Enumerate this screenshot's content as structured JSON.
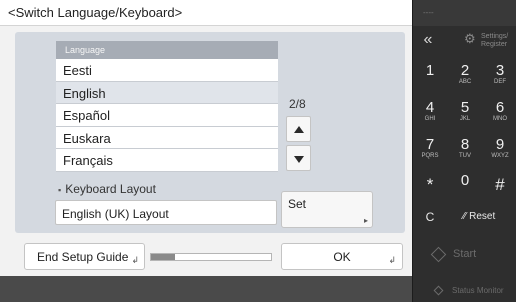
{
  "title": "<Switch Language/Keyboard>",
  "language_list": {
    "header": "Language",
    "items": [
      "Eesti",
      "English",
      "Español",
      "Euskara",
      "Français"
    ],
    "selected": "English"
  },
  "pager": {
    "indicator": "2/8",
    "up_icon": "triangle-up",
    "down_icon": "triangle-down"
  },
  "keyboard": {
    "label": "Keyboard Layout",
    "value": "English (UK) Layout",
    "set_label": "Set"
  },
  "footer": {
    "end_setup_label": "End Setup Guide",
    "progress_fraction": 0.2,
    "ok_label": "OK"
  },
  "keypad": {
    "top_indicator": "----",
    "back_icon": "double-chevron-left",
    "settings_line1": "Settings/",
    "settings_line2": "Register",
    "keys": [
      {
        "main": "1",
        "sub": ""
      },
      {
        "main": "2",
        "sub": "ABC"
      },
      {
        "main": "3",
        "sub": "DEF"
      },
      {
        "main": "4",
        "sub": "GHI"
      },
      {
        "main": "5",
        "sub": "JKL"
      },
      {
        "main": "6",
        "sub": "MNO"
      },
      {
        "main": "7",
        "sub": "PQRS"
      },
      {
        "main": "8",
        "sub": "TUV"
      },
      {
        "main": "9",
        "sub": "WXYZ"
      },
      {
        "main": "*",
        "sub": ""
      },
      {
        "main": "0",
        "sub": ""
      },
      {
        "main": "#",
        "sub": ""
      }
    ],
    "clear_label": "C",
    "reset_label": "Reset",
    "start_label": "Start",
    "status_monitor_label": "Status Monitor"
  },
  "colors": {
    "panel": "#d4d9e0",
    "list_header": "#a6acb5",
    "selected_row": "#e0e4ea",
    "keypad_bg": "#2e2e2e"
  }
}
